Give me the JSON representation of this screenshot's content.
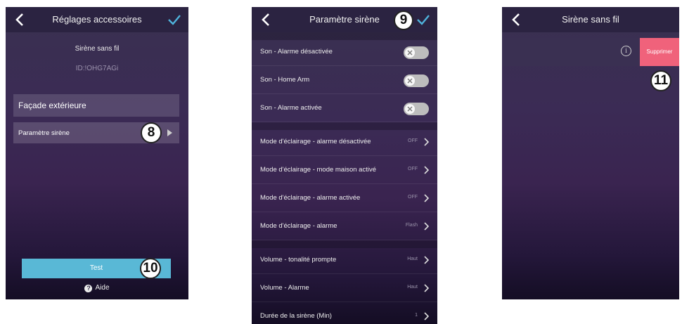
{
  "screen1": {
    "title": "Réglages accessoires",
    "device_name": "Sirène sans fil",
    "device_id": "ID:!OHG7AGi",
    "location_value": "Façade extérieure",
    "param_label": "Paramètre sirène",
    "test_label": "Test",
    "help_label": "Aide",
    "badge_param": "8",
    "badge_test": "10"
  },
  "screen2": {
    "title": "Paramètre sirène",
    "badge_save": "9",
    "toggles": [
      {
        "label": "Son - Alarme désactivée"
      },
      {
        "label": "Son - Home Arm"
      },
      {
        "label": "Son - Alarme activée"
      }
    ],
    "lighting": [
      {
        "label": "Mode d'éclairage - alarme désactivée",
        "value": "OFF"
      },
      {
        "label": "Mode d'éclairage - mode maison activé",
        "value": "OFF"
      },
      {
        "label": "Mode d'éclairage - alarme activée",
        "value": "OFF"
      },
      {
        "label": "Mode d'éclairage - alarme",
        "value": "Flash"
      }
    ],
    "volume": [
      {
        "label": "Volume - tonalité prompte",
        "value": "Haut"
      },
      {
        "label": "Volume - Alarme",
        "value": "Haut"
      },
      {
        "label": "Durée de la sirène (Min)",
        "value": "1"
      }
    ]
  },
  "screen3": {
    "title": "Sirène sans fil",
    "info_symbol": "i",
    "delete_label": "Supprimer",
    "badge_delete": "11"
  },
  "colors": {
    "accent_blue": "#59b8d6",
    "check_blue": "#4fb3dc",
    "delete_pink": "#f0627b",
    "topbar": "#2b2341"
  },
  "icons": [
    "back-chevron-icon",
    "checkmark-icon",
    "toggle-x-icon",
    "chevron-right-icon",
    "play-triangle-icon",
    "help-circle-icon",
    "info-icon"
  ]
}
